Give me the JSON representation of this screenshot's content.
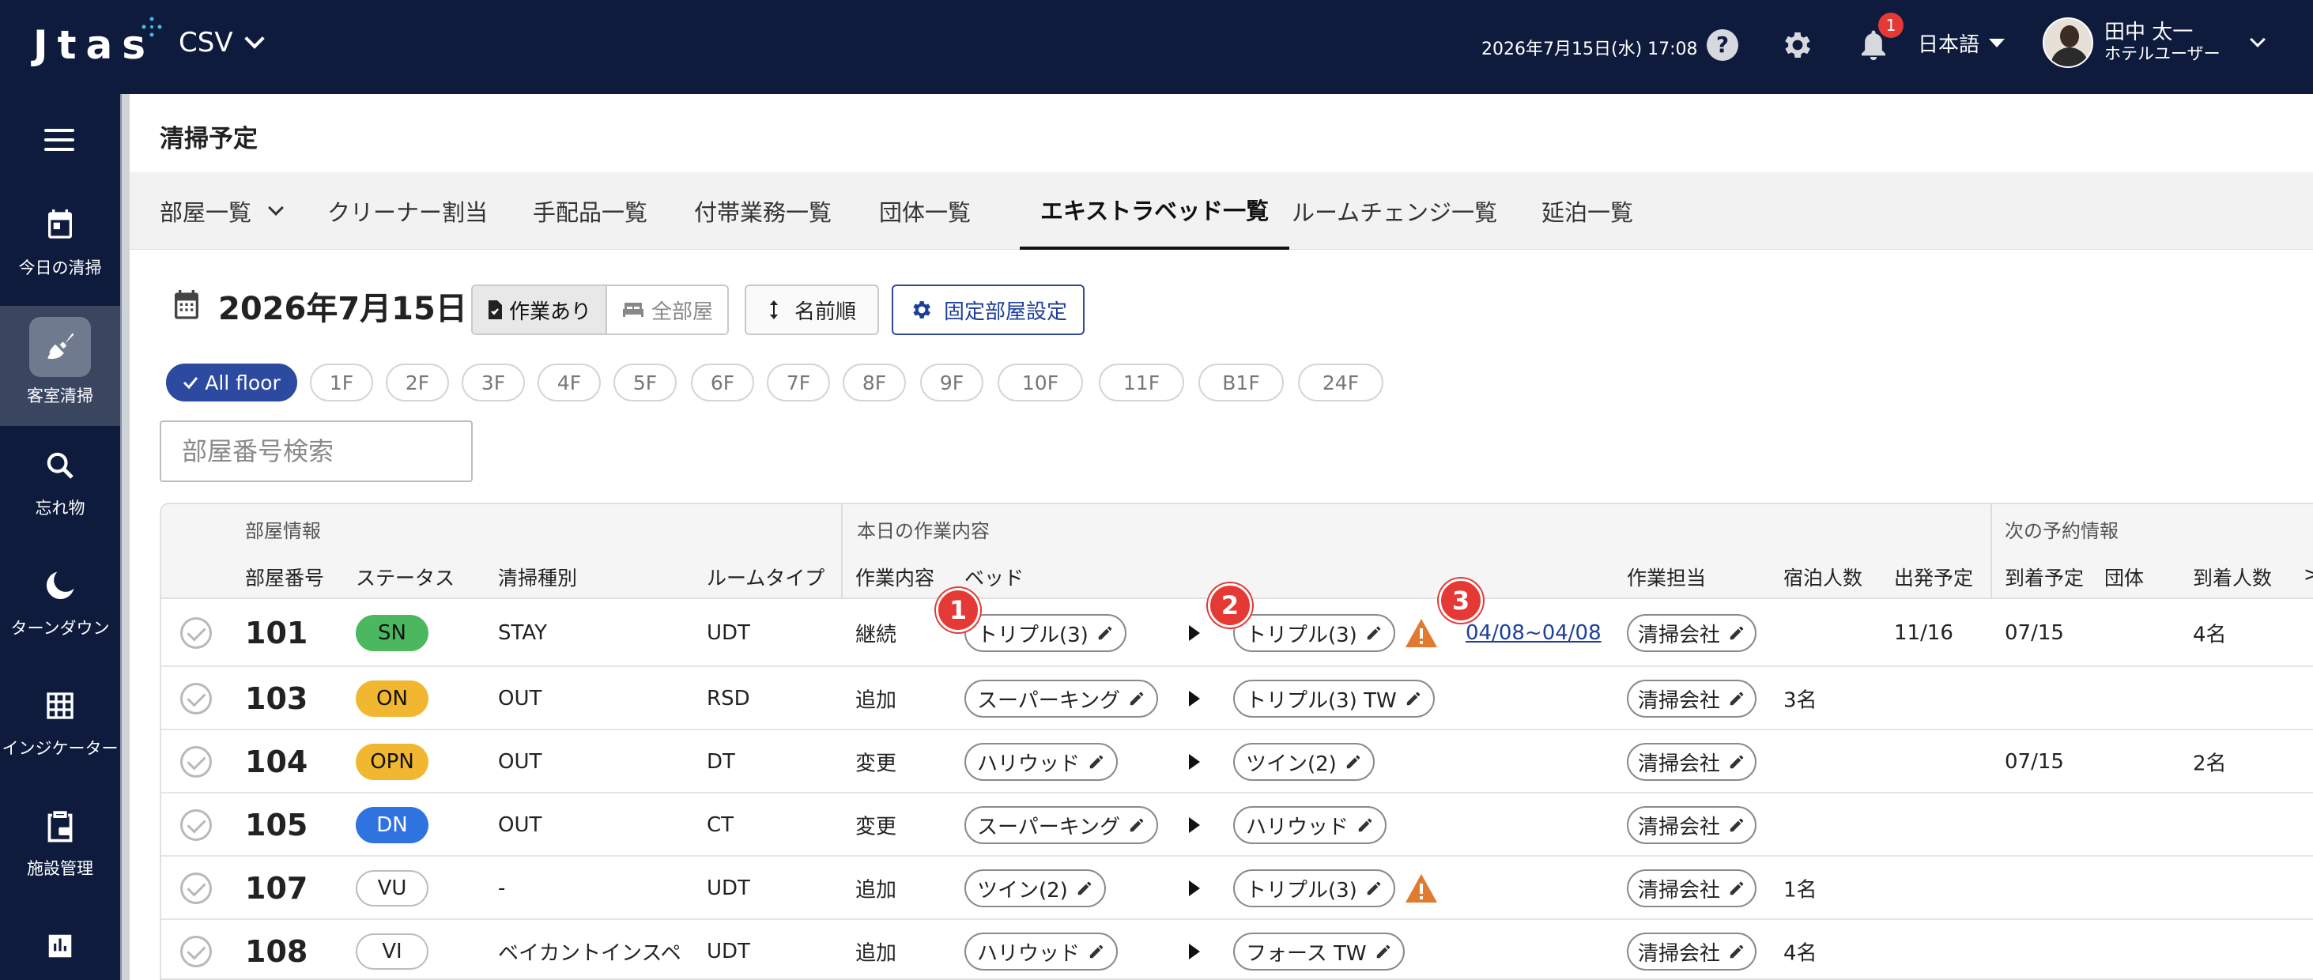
{
  "header": {
    "logo": "Jtas",
    "app_name": "CSV",
    "datetime": "2026年7月15日(水) 17:08",
    "notification_count": "1",
    "language": "日本語",
    "user_name": "田中 太一",
    "user_role": "ホテルユーザー"
  },
  "sidebar": {
    "items": [
      {
        "label": "今日の清掃",
        "icon": "calendar-icon"
      },
      {
        "label": "客室清掃",
        "icon": "broom-icon",
        "active": true
      },
      {
        "label": "忘れ物",
        "icon": "search-icon"
      },
      {
        "label": "ターンダウン",
        "icon": "moon-icon"
      },
      {
        "label": "インジケーター",
        "icon": "grid-icon"
      },
      {
        "label": "施設管理",
        "icon": "clipboard-icon"
      },
      {
        "label": "",
        "icon": "chart-icon"
      }
    ]
  },
  "page": {
    "title": "清掃予定",
    "tabs": [
      "部屋一覧",
      "クリーナー割当",
      "手配品一覧",
      "付帯業務一覧",
      "団体一覧",
      "エキストラベッド一覧",
      "ルームチェンジ一覧",
      "延泊一覧"
    ],
    "active_tab": "エキストラベッド一覧",
    "date": "2026年7月15日",
    "filter_work": "作業あり",
    "filter_all": "全部屋",
    "sort_label": "名前順",
    "fixed_room_label": "固定部屋設定",
    "floors": [
      "All floor",
      "1F",
      "2F",
      "3F",
      "4F",
      "5F",
      "6F",
      "7F",
      "8F",
      "9F",
      "10F",
      "11F",
      "B1F",
      "24F"
    ],
    "search_placeholder": "部屋番号検索"
  },
  "table": {
    "group_headers": {
      "room_info": "部屋情報",
      "today_work": "本日の作業内容",
      "next_reservation": "次の予約情報"
    },
    "columns": {
      "room_no": "部屋番号",
      "status": "ステータス",
      "clean_type": "清掃種別",
      "room_type": "ルームタイプ",
      "work": "作業内容",
      "bed": "ベッド",
      "staff": "作業担当",
      "guests": "宿泊人数",
      "checkout": "出発予定",
      "arrival": "到着予定",
      "group": "団体",
      "arrival_count": "到着人数",
      "more": ">"
    },
    "rows": [
      {
        "room": "101",
        "status": "SN",
        "clean_type": "STAY",
        "room_type": "UDT",
        "work": "継続",
        "bed_from": "トリプル(3)",
        "bed_to": "トリプル(3)",
        "warning": true,
        "period": "04/08~04/08",
        "staff": "清掃会社",
        "guests": "",
        "checkout": "11/16",
        "arrival": "07/15",
        "arrival_count": "4名"
      },
      {
        "room": "103",
        "status": "ON",
        "clean_type": "OUT",
        "room_type": "RSD",
        "work": "追加",
        "bed_from": "スーパーキング",
        "bed_to": "トリプル(3) TW",
        "warning": false,
        "period": "",
        "staff": "清掃会社",
        "guests": "3名",
        "checkout": "",
        "arrival": "",
        "arrival_count": ""
      },
      {
        "room": "104",
        "status": "OPN",
        "clean_type": "OUT",
        "room_type": "DT",
        "work": "変更",
        "bed_from": "ハリウッド",
        "bed_to": "ツイン(2)",
        "warning": false,
        "period": "",
        "staff": "清掃会社",
        "guests": "",
        "checkout": "",
        "arrival": "07/15",
        "arrival_count": "2名"
      },
      {
        "room": "105",
        "status": "DN",
        "clean_type": "OUT",
        "room_type": "CT",
        "work": "変更",
        "bed_from": "スーパーキング",
        "bed_to": "ハリウッド",
        "warning": false,
        "period": "",
        "staff": "清掃会社",
        "guests": "",
        "checkout": "",
        "arrival": "",
        "arrival_count": ""
      },
      {
        "room": "107",
        "status": "VU",
        "clean_type": "-",
        "room_type": "UDT",
        "work": "追加",
        "bed_from": "ツイン(2)",
        "bed_to": "トリプル(3)",
        "warning": true,
        "period": "",
        "staff": "清掃会社",
        "guests": "1名",
        "checkout": "",
        "arrival": "",
        "arrival_count": ""
      },
      {
        "room": "108",
        "status": "VI",
        "clean_type": "ベイカントインスペ",
        "room_type": "UDT",
        "work": "追加",
        "bed_from": "ハリウッド",
        "bed_to": "フォース TW",
        "warning": false,
        "period": "",
        "staff": "清掃会社",
        "guests": "4名",
        "checkout": "",
        "arrival": "",
        "arrival_count": ""
      }
    ]
  },
  "markers": [
    "1",
    "2",
    "3"
  ],
  "colors": {
    "navy": "#0e1b3d",
    "accent_blue": "#2c4aa0",
    "warning_orange": "#e07a2e",
    "marker_red": "#e53935"
  }
}
